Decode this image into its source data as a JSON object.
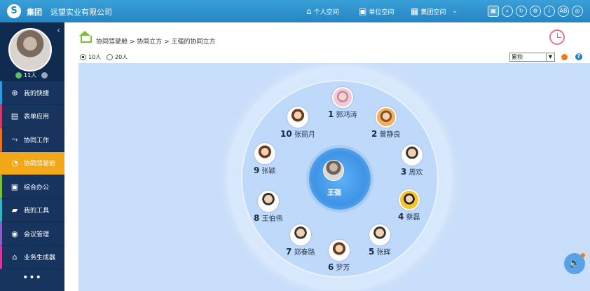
{
  "topbar": {
    "brand": "集团",
    "company": "远望实业有限公司",
    "nav": [
      {
        "label": "个人空间",
        "icon": "home-icon"
      },
      {
        "label": "单位空间",
        "icon": "bus-icon"
      },
      {
        "label": "集团空间",
        "icon": "building-icon"
      }
    ],
    "tools": [
      "grid-icon",
      "search-icon",
      "refresh-icon",
      "settings-icon",
      "info-icon",
      "ab-icon",
      "logout-icon"
    ]
  },
  "sidebar": {
    "online_count": "11人",
    "items": [
      {
        "label": "我的快捷",
        "icon": "plus-icon",
        "color": "#2c9be0"
      },
      {
        "label": "表单应用",
        "icon": "table-icon",
        "color": "#d23a6a"
      },
      {
        "label": "协同工作",
        "icon": "share-icon",
        "color": "#e6731e"
      },
      {
        "label": "协同驾驶舱",
        "icon": "dashboard-icon",
        "color": "#f3a81a"
      },
      {
        "label": "综合办公",
        "icon": "office-icon",
        "color": "#7cbf3a"
      },
      {
        "label": "我的工具",
        "icon": "toolbox-icon",
        "color": "#34b3c6"
      },
      {
        "label": "会议管理",
        "icon": "meeting-icon",
        "color": "#8a5cc6"
      },
      {
        "label": "业务生成器",
        "icon": "builder-icon",
        "color": "#d23a9a"
      }
    ],
    "active_index": 3,
    "more": "•••"
  },
  "breadcrumb": {
    "text": "协同驾驶舱 > 协同立方 > 王强的协同立方"
  },
  "options": {
    "opt10": "10人",
    "opt20": "20人",
    "selected": "10人",
    "sort_select": "累积"
  },
  "center": {
    "name": "王强"
  },
  "people": [
    {
      "num": "1",
      "name": "郭鸿涛",
      "style": "p"
    },
    {
      "num": "2",
      "name": "曾静良",
      "style": "o"
    },
    {
      "num": "3",
      "name": "周欢",
      "style": "m"
    },
    {
      "num": "4",
      "name": "蔡磊",
      "style": "y"
    },
    {
      "num": "5",
      "name": "张辉",
      "style": "m"
    },
    {
      "num": "6",
      "name": "罗芳",
      "style": "f"
    },
    {
      "num": "7",
      "name": "郑春路",
      "style": "m"
    },
    {
      "num": "8",
      "name": "王伯伟",
      "style": "m"
    },
    {
      "num": "9",
      "name": "张颖",
      "style": "f"
    },
    {
      "num": "10",
      "name": "张丽月",
      "style": "f"
    }
  ]
}
